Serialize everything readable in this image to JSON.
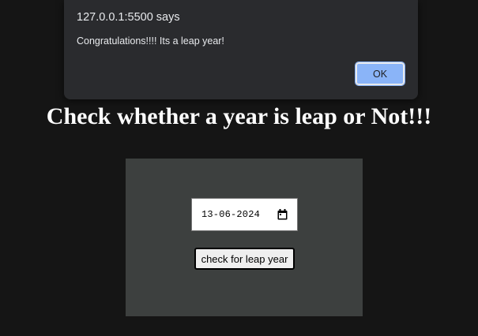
{
  "alert": {
    "title": "127.0.0.1:5500 says",
    "message": "Congratulations!!!! Its a leap year!",
    "ok_label": "OK"
  },
  "heading": "Check whether a year is leap or Not!!!",
  "form": {
    "date_value": "13-06-2024",
    "calendar_icon": "calendar-icon",
    "button_label": "check for leap year"
  },
  "colors": {
    "page_background": "#151515",
    "dialog_background": "#2a2b2e",
    "ok_button": "#8ab4f8",
    "panel_background": "#3d403f"
  }
}
